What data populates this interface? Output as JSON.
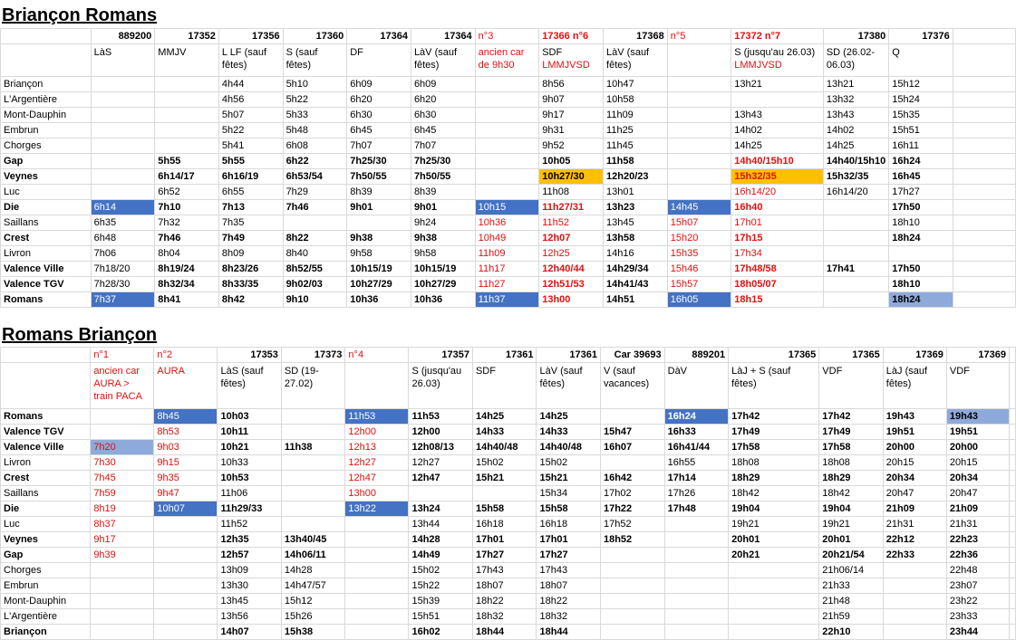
{
  "top": {
    "title": "Briançon Romans",
    "cols": [
      {
        "num": "889200",
        "label": "LàS"
      },
      {
        "num": "17352",
        "label": "MMJV"
      },
      {
        "num": "17356",
        "label": "L LF (sauf fêtes)"
      },
      {
        "num": "17360",
        "label": "S (sauf fêtes)"
      },
      {
        "num": "17364",
        "label": "DF"
      },
      {
        "num": "17364",
        "label": "LàV (sauf fêtes)"
      },
      {
        "num": "n°3",
        "label": "ancien car de 9h30"
      },
      {
        "num": "17366 n°6",
        "label": "SDF",
        "label2": "LMMJVSD"
      },
      {
        "num": "17368",
        "label": "LàV (sauf fêtes)"
      },
      {
        "num": "n°5",
        "label": ""
      },
      {
        "num": "17372 n°7",
        "label": "S (jusqu'au 26.03)",
        "label2": "LMMJVSD"
      },
      {
        "num": "17380",
        "label": "SD (26.02-06.03)"
      },
      {
        "num": "17376",
        "label": "Q"
      }
    ],
    "rows": [
      {
        "station": "Briançon",
        "times": [
          "",
          "",
          "4h44",
          "5h10",
          "6h09",
          "6h09",
          "",
          "8h56",
          "10h47",
          "",
          "13h21",
          "13h21",
          "15h12"
        ]
      },
      {
        "station": "L'Argentière",
        "times": [
          "",
          "",
          "4h56",
          "5h22",
          "6h20",
          "6h20",
          "",
          "9h07",
          "10h58",
          "",
          "",
          "13h32",
          "15h24"
        ]
      },
      {
        "station": "Mont-Dauphin",
        "times": [
          "",
          "",
          "5h07",
          "5h33",
          "6h30",
          "6h30",
          "",
          "9h17",
          "11h09",
          "",
          "13h43",
          "13h43",
          "15h35"
        ]
      },
      {
        "station": "Embrun",
        "times": [
          "",
          "",
          "5h22",
          "5h48",
          "6h45",
          "6h45",
          "",
          "9h31",
          "11h25",
          "",
          "14h02",
          "14h02",
          "15h51"
        ]
      },
      {
        "station": "Chorges",
        "times": [
          "",
          "",
          "5h41",
          "6h08",
          "7h07",
          "7h07",
          "",
          "9h52",
          "11h45",
          "",
          "14h25",
          "14h25",
          "16h11"
        ]
      },
      {
        "station": "Gap",
        "times": [
          "",
          "5h55",
          "5h55",
          "6h22",
          "7h25/30",
          "7h25/30",
          "",
          "10h05",
          "11h58",
          "",
          "14h40/15h10",
          "14h40/15h10",
          "16h24"
        ]
      },
      {
        "station": "Veynes",
        "times": [
          "",
          "6h14/17",
          "6h16/19",
          "6h53/54",
          "7h50/55",
          "7h50/55",
          "",
          "10h27/30",
          "12h20/23",
          "",
          "15h32/35",
          "15h32/35",
          "16h45"
        ]
      },
      {
        "station": "Luc",
        "times": [
          "",
          "6h52",
          "6h55",
          "7h29",
          "8h39",
          "8h39",
          "",
          "11h08",
          "13h01",
          "",
          "16h14/20",
          "16h14/20",
          "17h27"
        ]
      },
      {
        "station": "Die",
        "times": [
          "6h14",
          "7h10",
          "7h13",
          "7h46",
          "9h01",
          "9h01",
          "10h15",
          "11h27/31",
          "13h23",
          "14h45",
          "16h40",
          "",
          "17h50"
        ]
      },
      {
        "station": "Saillans",
        "times": [
          "6h35",
          "7h32",
          "7h35",
          "",
          "",
          "9h24",
          "10h36",
          "11h52",
          "13h45",
          "15h07",
          "17h01",
          "",
          "18h10"
        ]
      },
      {
        "station": "Crest",
        "times": [
          "6h48",
          "7h46",
          "7h49",
          "8h22",
          "9h38",
          "9h38",
          "10h49",
          "12h07",
          "13h58",
          "15h20",
          "17h15",
          "",
          "18h24"
        ]
      },
      {
        "station": "Livron",
        "times": [
          "7h06",
          "8h04",
          "8h09",
          "8h40",
          "9h58",
          "9h58",
          "11h09",
          "12h25",
          "14h16",
          "15h35",
          "17h34",
          "",
          ""
        ]
      },
      {
        "station": "Valence Ville",
        "times": [
          "7h18/20",
          "8h19/24",
          "8h23/26",
          "8h52/55",
          "10h15/19",
          "10h15/19",
          "11h17",
          "12h40/44",
          "14h29/34",
          "15h46",
          "17h48/58",
          "17h41",
          "17h50"
        ]
      },
      {
        "station": "Valence TGV",
        "times": [
          "7h28/30",
          "8h32/34",
          "8h33/35",
          "9h02/03",
          "10h27/29",
          "10h27/29",
          "11h27",
          "12h51/53",
          "14h41/43",
          "15h57",
          "18h05/07",
          "",
          "18h10"
        ]
      },
      {
        "station": "Romans",
        "times": [
          "7h37",
          "8h41",
          "8h42",
          "9h10",
          "10h36",
          "10h36",
          "11h37",
          "13h00",
          "14h51",
          "16h05",
          "18h15",
          "",
          "18h24"
        ]
      }
    ]
  },
  "bottom": {
    "title": "Romans Briançon",
    "cols": [
      {
        "num": "n°1",
        "label": "ancien car AURA > train PACA"
      },
      {
        "num": "n°2",
        "label": "AURA"
      },
      {
        "num": "17353",
        "label": "LàS (sauf fêtes)"
      },
      {
        "num": "17373",
        "label": "SD (19-27.02)"
      },
      {
        "num": "n°4",
        "label": ""
      },
      {
        "num": "17357",
        "label": "S (jusqu'au 26.03)"
      },
      {
        "num": "17361",
        "label": "SDF"
      },
      {
        "num": "17361",
        "label": "LàV (sauf fêtes)"
      },
      {
        "num": "Car 39693",
        "label": "V (sauf vacances)"
      },
      {
        "num": "889201",
        "label": "DàV"
      },
      {
        "num": "17365",
        "label": "LàJ + S (sauf fêtes)"
      },
      {
        "num": "17365",
        "label": "VDF"
      },
      {
        "num": "17369",
        "label": "LàJ (sauf fêtes)"
      },
      {
        "num": "17369",
        "label": "VDF"
      }
    ],
    "rows": [
      {
        "station": "Romans",
        "times": [
          "",
          "8h45",
          "10h03",
          "",
          "11h53",
          "11h53",
          "14h25",
          "14h25",
          "",
          "16h24",
          "17h42",
          "17h42",
          "19h43",
          "19h43"
        ]
      },
      {
        "station": "Valence TGV",
        "times": [
          "",
          "8h53",
          "10h11",
          "",
          "12h00",
          "12h00",
          "14h33",
          "14h33",
          "15h47",
          "16h33",
          "17h49",
          "17h49",
          "19h51",
          "19h51"
        ]
      },
      {
        "station": "Valence Ville",
        "times": [
          "7h20",
          "9h03",
          "10h21",
          "11h38",
          "12h13",
          "12h08/13",
          "14h40/48",
          "14h40/48",
          "16h07",
          "16h41/44",
          "17h58",
          "17h58",
          "20h00",
          "20h00"
        ]
      },
      {
        "station": "Livron",
        "times": [
          "7h30",
          "9h15",
          "10h33",
          "",
          "12h27",
          "12h27",
          "15h02",
          "15h02",
          "",
          "16h55",
          "18h08",
          "18h08",
          "20h15",
          "20h15"
        ]
      },
      {
        "station": "Crest",
        "times": [
          "7h45",
          "9h35",
          "10h53",
          "",
          "12h47",
          "12h47",
          "15h21",
          "15h21",
          "16h42",
          "17h14",
          "18h29",
          "18h29",
          "20h34",
          "20h34"
        ]
      },
      {
        "station": "Saillans",
        "times": [
          "7h59",
          "9h47",
          "11h06",
          "",
          "13h00",
          "",
          "",
          "15h34",
          "17h02",
          "17h26",
          "18h42",
          "18h42",
          "20h47",
          "20h47"
        ]
      },
      {
        "station": "Die",
        "times": [
          "8h19",
          "10h07",
          "11h29/33",
          "",
          "13h22",
          "13h24",
          "15h58",
          "15h58",
          "17h22",
          "17h48",
          "19h04",
          "19h04",
          "21h09",
          "21h09"
        ]
      },
      {
        "station": "Luc",
        "times": [
          "8h37",
          "",
          "11h52",
          "",
          "",
          "13h44",
          "16h18",
          "16h18",
          "17h52",
          "",
          "19h21",
          "19h21",
          "21h31",
          "21h31"
        ]
      },
      {
        "station": "Veynes",
        "times": [
          "9h17",
          "",
          "12h35",
          "13h40/45",
          "",
          "14h28",
          "17h01",
          "17h01",
          "18h52",
          "",
          "20h01",
          "20h01",
          "22h12",
          "22h23"
        ]
      },
      {
        "station": "Gap",
        "times": [
          "9h39",
          "",
          "12h57",
          "14h06/11",
          "",
          "14h49",
          "17h27",
          "17h27",
          "",
          "",
          "20h21",
          "20h21/54",
          "22h33",
          "22h36"
        ]
      },
      {
        "station": "Chorges",
        "times": [
          "",
          "",
          "13h09",
          "14h28",
          "",
          "15h02",
          "17h43",
          "17h43",
          "",
          "",
          "",
          "21h06/14",
          "",
          "22h48"
        ]
      },
      {
        "station": "Embrun",
        "times": [
          "",
          "",
          "13h30",
          "14h47/57",
          "",
          "15h22",
          "18h07",
          "18h07",
          "",
          "",
          "",
          "21h33",
          "",
          "23h07"
        ]
      },
      {
        "station": "Mont-Dauphin",
        "times": [
          "",
          "",
          "13h45",
          "15h12",
          "",
          "15h39",
          "18h22",
          "18h22",
          "",
          "",
          "",
          "21h48",
          "",
          "23h22"
        ]
      },
      {
        "station": "L'Argentière",
        "times": [
          "",
          "",
          "13h56",
          "15h26",
          "",
          "15h51",
          "18h32",
          "18h32",
          "",
          "",
          "",
          "21h59",
          "",
          "23h33"
        ]
      },
      {
        "station": "Briançon",
        "times": [
          "",
          "",
          "14h07",
          "15h38",
          "",
          "16h02",
          "18h44",
          "18h44",
          "",
          "",
          "",
          "22h10",
          "",
          "23h44"
        ]
      }
    ]
  }
}
